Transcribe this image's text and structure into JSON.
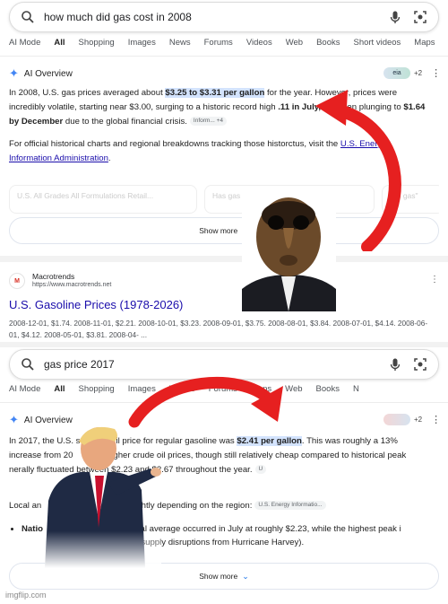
{
  "colors": {
    "link": "#1a0dab",
    "highlight": "#d3e3fd",
    "ai_star": "#4285f4",
    "arrow_red": "#e62020"
  },
  "screen1": {
    "search": {
      "query": "how much did gas cost in 2008"
    },
    "tabs": [
      "AI Mode",
      "All",
      "Shopping",
      "Images",
      "News",
      "Forums",
      "Videos",
      "Web",
      "Books",
      "Short videos",
      "Maps",
      "F"
    ],
    "active_tab": "All",
    "ai_overview": {
      "title": "AI Overview",
      "sources_count": "+2",
      "sources_chip": "eia",
      "p1_a": "In 2008, U.S. gas prices averaged about ",
      "p1_hl": "$3.25 to $3.31 per gallon",
      "p1_b": " for the year. However, prices were incredibly volatile, starting near $3.00, surging to a historic record high ",
      "p1_bold": ".11 in July,",
      "p1_c": " and then plunging to ",
      "p1_bold2": "$1.64 by December",
      "p1_d": " due to the global financial crisis.",
      "p1_cite": "Inform... +4",
      "p2_a": "For official historical charts and regional breakdowns tracking those histor",
      "p2_b": "ctu",
      "p2_c": "s, visit the ",
      "p2_link": "U.S. Energy Information Administration",
      "p2_end": ".",
      "cards": [
        "U.S. All Grades All Formulations Retail...",
        "Has gas ever... impossible...",
        "\"$5 gas\""
      ],
      "show_more": "Show more"
    },
    "result": {
      "site_name": "Macrotrends",
      "site_url": "https://www.macrotrends.net",
      "title": "U.S. Gasoline Prices (1978-2026)",
      "snippet": "2008-12-01, $1.74. 2008-11-01, $2.21. 2008-10-01, $3.23. 2008-09-01, $3.75. 2008-08-01, $3.84. 2008-07-01, $4.14. 2008-06-01, $4.12. 2008-05-01, $3.81. 2008-04- ..."
    }
  },
  "screen2": {
    "search": {
      "query": "gas price 2017"
    },
    "tabs": [
      "AI Mode",
      "All",
      "Shopping",
      "Images",
      "Videos",
      "Forums",
      "Maps",
      "Web",
      "Books",
      "N"
    ],
    "active_tab": "All",
    "ai_overview": {
      "title": "AI Overview",
      "sources_count": "+2",
      "p1_a": "In 2017, the U.S. s",
      "p1_b": "il price for regular gasoline was ",
      "p1_hl": "$2.41 per gallon",
      "p1_c": ". This was roughly a 13% increase from 20",
      "p1_d": "y higher crude oil prices, though still relatively cheap compared to historical peak",
      "p1_e": "nerally fluctuated between $2.23 and $2.67 throughout the year.",
      "p1_cite": "U",
      "p2_a": "Local an",
      "p2_b": "nds varied slightly depending on the region:",
      "p2_cite": "U.S. Energy Informatio...",
      "bullet_a": "Natio",
      "bullet_b": "west national average occurred in July at roughly $2.23, while the highest peak i",
      "bullet_c": "ember (largely due to supply disruptions from Hurricane Harvey).",
      "show_more": "Show more"
    }
  },
  "watermark": "imgflip.com"
}
